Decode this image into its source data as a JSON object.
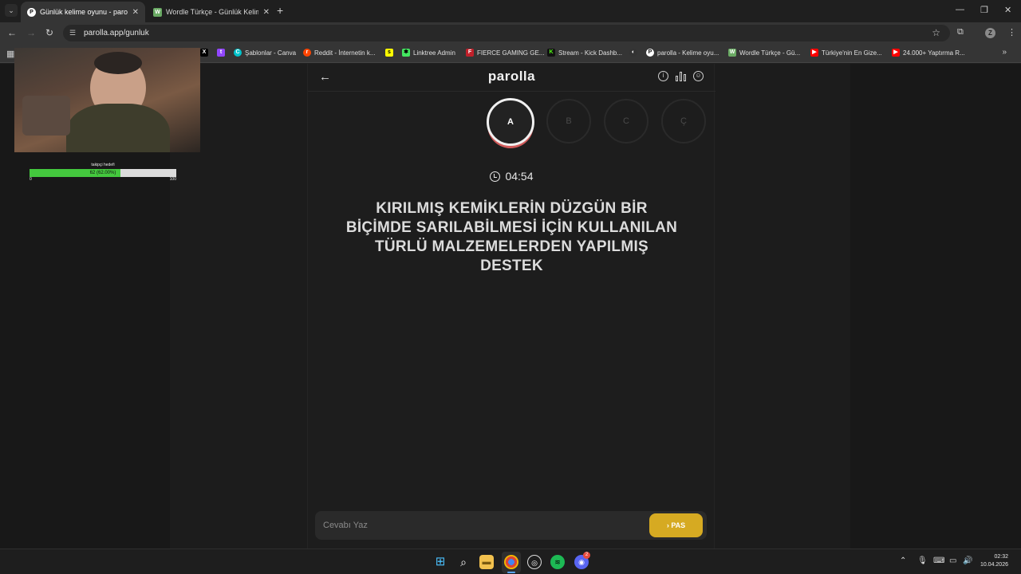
{
  "browser": {
    "tabs": [
      {
        "title": "Günlük kelime oyunu - parolla",
        "active": true,
        "favicon": "parolla-icon"
      },
      {
        "title": "Wordle Türkçe - Günlük Kelime",
        "active": false,
        "favicon": "wordle-icon"
      }
    ],
    "url": "parolla.app/gunluk",
    "profile_initial": "Z",
    "bookmarks": [
      {
        "label": "",
        "icon": "x-icon",
        "color": "#1f1f1f"
      },
      {
        "label": "",
        "icon": "twitch-icon",
        "color": "#9146ff"
      },
      {
        "label": "Şablonlar - Canva",
        "icon": "canva-icon",
        "color": "#00c4cc"
      },
      {
        "label": "Reddit - İnternetin k...",
        "icon": "reddit-icon",
        "color": "#ff4500"
      },
      {
        "label": "",
        "icon": "snapchat-icon",
        "color": "#fffc00"
      },
      {
        "label": "Linktree Admin",
        "icon": "linktree-icon",
        "color": "#43e660"
      },
      {
        "label": "FIERCE GAMING GE...",
        "icon": "fierce-icon",
        "color": "#c0202a"
      },
      {
        "label": "Stream - Kick Dashb...",
        "icon": "kick-icon",
        "color": "#53fc18"
      },
      {
        "label": "",
        "icon": "github-icon",
        "color": "#333333"
      },
      {
        "label": "parolla - Kelime oyu...",
        "icon": "parolla-icon",
        "color": "#ffffff"
      },
      {
        "label": "Wordle Türkçe - Gü...",
        "icon": "wordle-icon",
        "color": "#6aaa64"
      },
      {
        "label": "Türkiye'nin En Gize...",
        "icon": "youtube-icon",
        "color": "#ff0000"
      },
      {
        "label": "24.000+ Yaptırma R...",
        "icon": "youtube-icon",
        "color": "#ff0000"
      }
    ]
  },
  "app": {
    "logo": "parolla",
    "letters": [
      "A",
      "B",
      "C",
      "Ç"
    ],
    "active_letter_index": 0,
    "timer": "04:54",
    "question": "KIRILMIŞ KEMİKLERİN DÜZGÜN BİR BİÇİMDE SARILABİLMESİ İÇİN KULLANILAN TÜRLÜ MALZEMELERDEN YAPILMIŞ DESTEK",
    "answer": {
      "placeholder": "Cevabı Yaz",
      "value": ""
    },
    "pass_button": "PAS",
    "accent_color": "#d6aa22"
  },
  "overlay": {
    "goal_title": "takipçi hedefi",
    "goal_text": "62 (62.00%)",
    "goal_current": 62,
    "goal_min": "0",
    "goal_max": "100",
    "goal_fraction": 0.62
  },
  "taskbar": {
    "time": "02:32",
    "date": "10.04.2026",
    "discord_badge": "2"
  }
}
